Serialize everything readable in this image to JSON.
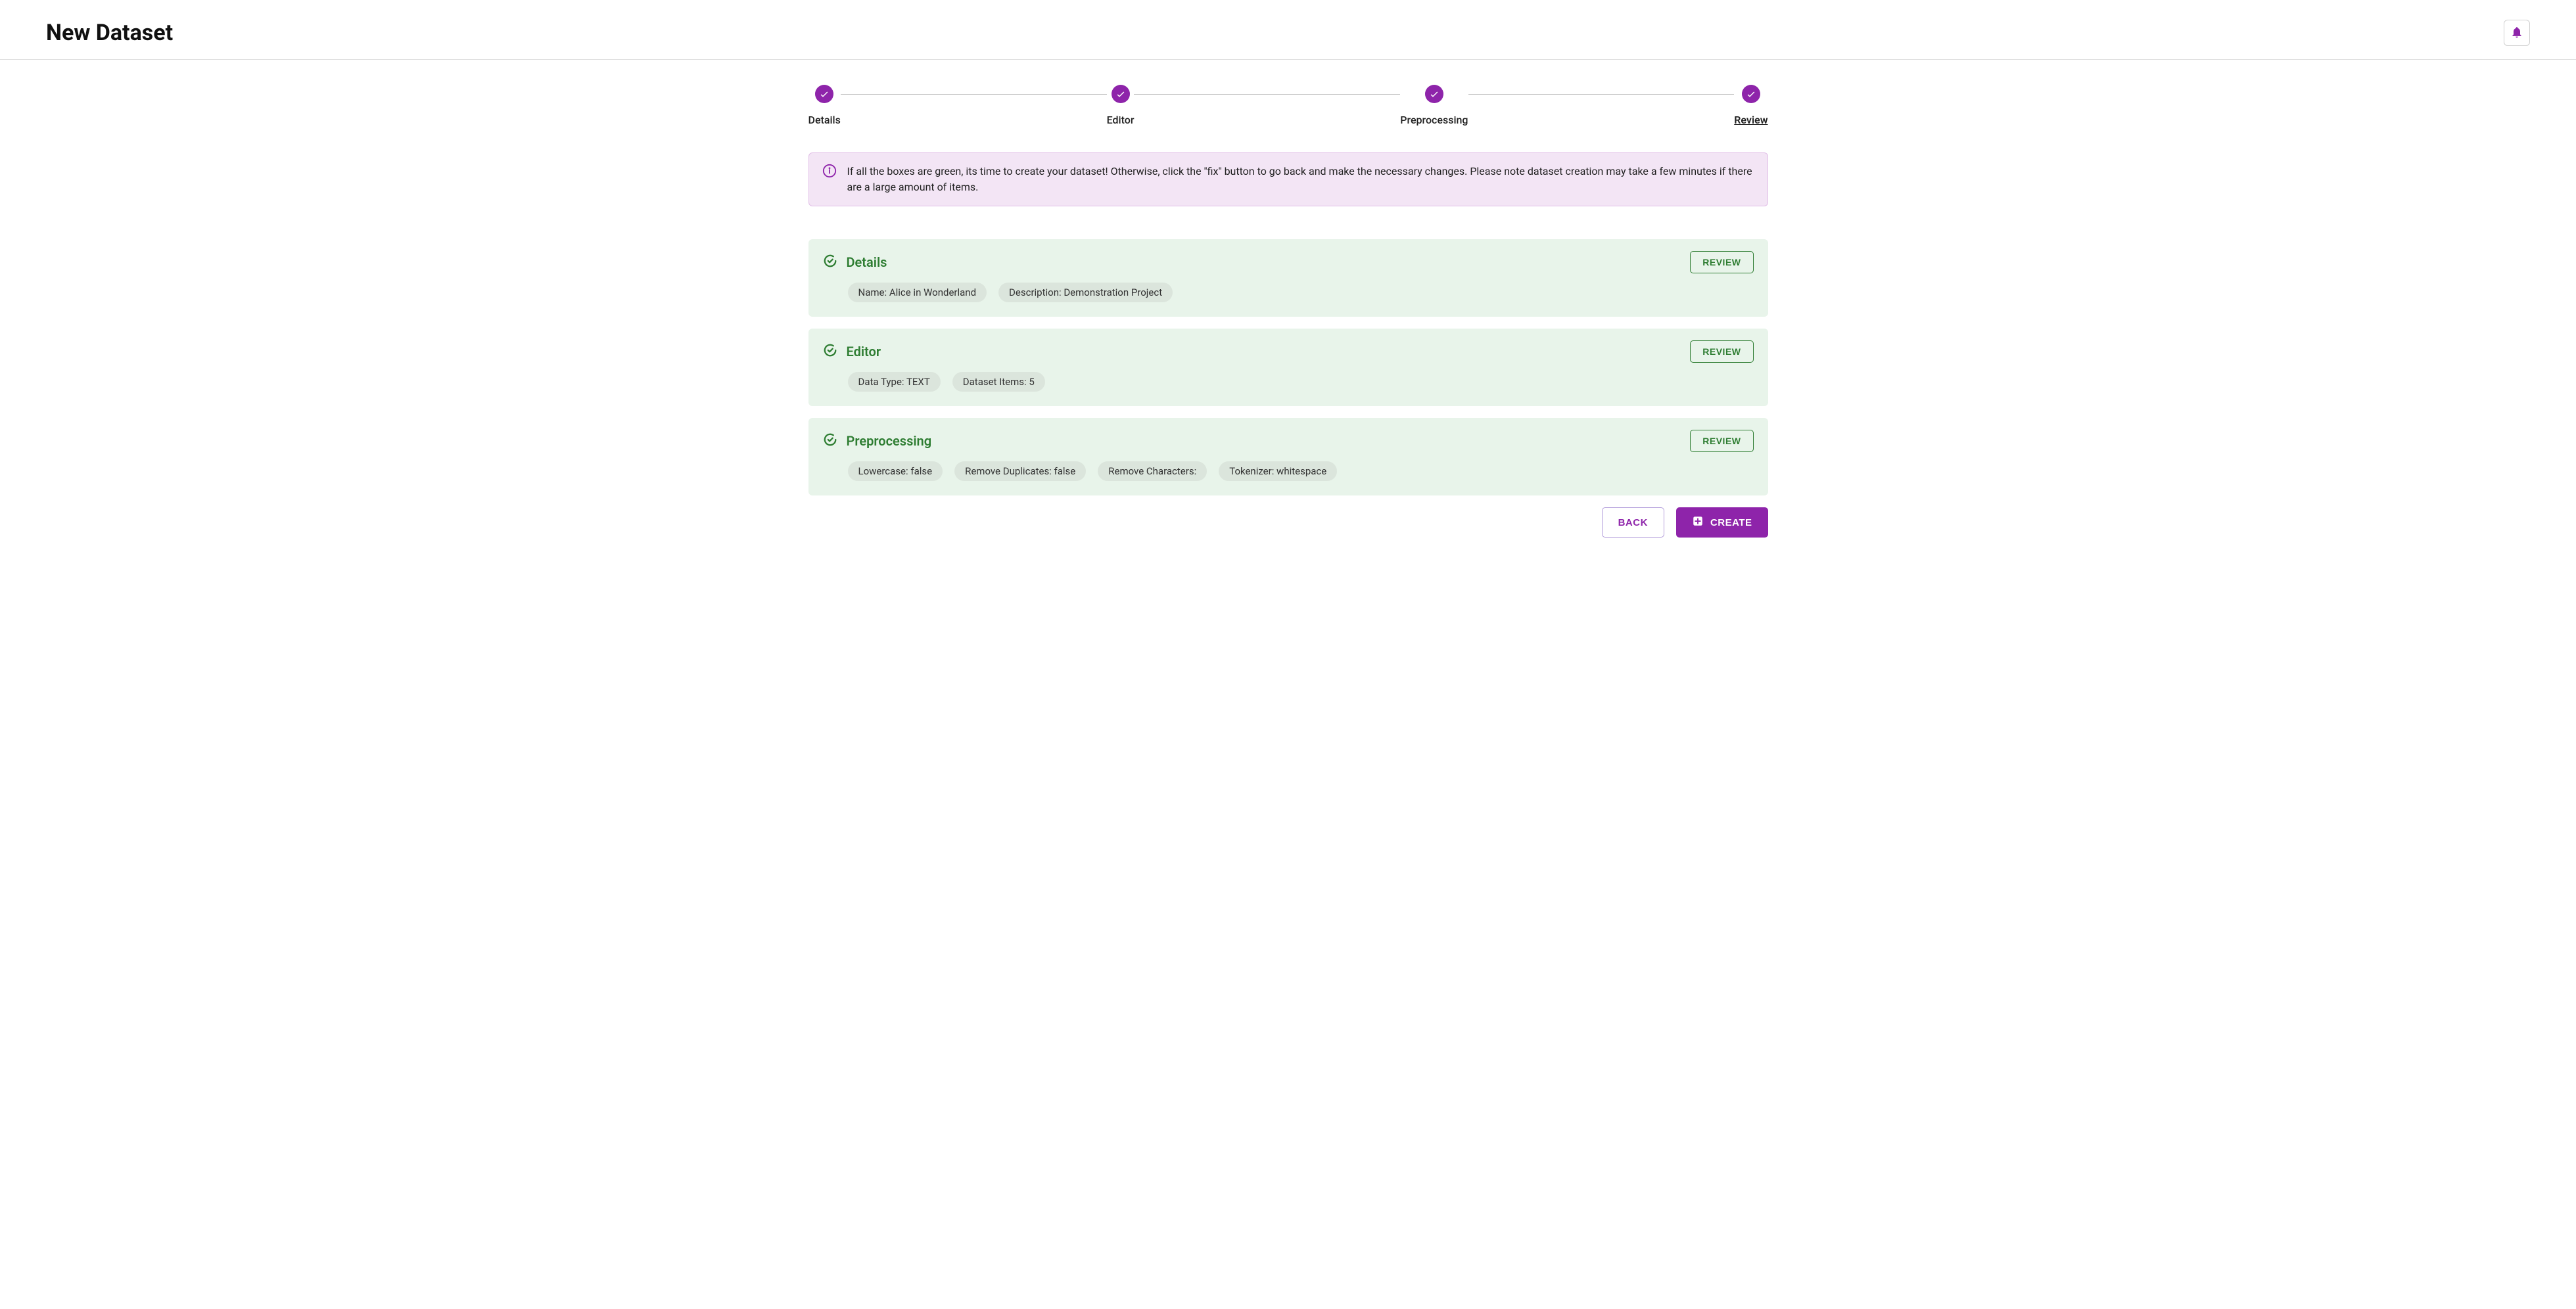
{
  "header": {
    "title": "New Dataset"
  },
  "stepper": {
    "steps": [
      "Details",
      "Editor",
      "Preprocessing",
      "Review"
    ],
    "active_index": 3
  },
  "alert": {
    "text": "If all the boxes are green, its time to create your dataset! Otherwise, click the \"fix\" button to go back and make the necessary changes. Please note dataset creation may take a few minutes if there are a large amount of items."
  },
  "sections": [
    {
      "title": "Details",
      "review_label": "REVIEW",
      "chips": [
        "Name: Alice in Wonderland",
        "Description: Demonstration Project"
      ]
    },
    {
      "title": "Editor",
      "review_label": "REVIEW",
      "chips": [
        "Data Type: TEXT",
        "Dataset Items: 5"
      ]
    },
    {
      "title": "Preprocessing",
      "review_label": "REVIEW",
      "chips": [
        "Lowercase: false",
        "Remove Duplicates: false",
        "Remove Characters:",
        "Tokenizer: whitespace"
      ]
    }
  ],
  "footer": {
    "back": "BACK",
    "create": "CREATE"
  }
}
